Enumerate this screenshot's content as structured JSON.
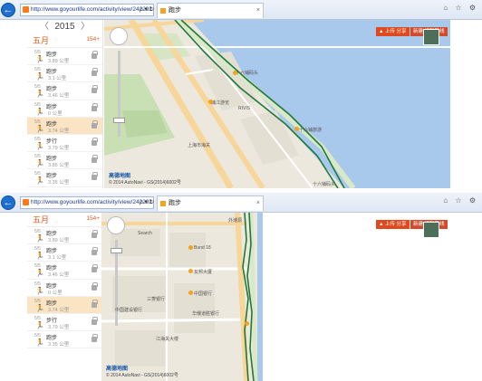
{
  "browser": {
    "back_icon": "←",
    "address": "http://www.goyourlife.com/activity/view/242292",
    "address_controls": "ρ ▾ ↻ ✕",
    "tab_title": "跑步",
    "tab_close": "×",
    "window_controls": "⌂ ☆ ⚙"
  },
  "sidebar_top": {
    "year": "2015",
    "prev": "〈",
    "next": "〉",
    "month": "五月",
    "month_count": "154+",
    "activities": [
      {
        "date": "5/5",
        "type": "跑步",
        "dist": "3.89 公里",
        "selected": false
      },
      {
        "date": "5/5",
        "type": "跑步",
        "dist": "3.1 公里",
        "selected": false
      },
      {
        "date": "5/5",
        "type": "跑步",
        "dist": "3.46 公里",
        "selected": false
      },
      {
        "date": "5/5",
        "type": "跑步",
        "dist": "0 公里",
        "selected": false
      },
      {
        "date": "5/5",
        "type": "跑步",
        "dist": "3.74 公里",
        "selected": true
      },
      {
        "date": "5/5",
        "type": "步行",
        "dist": "3.79 公里",
        "selected": false
      },
      {
        "date": "5/5",
        "type": "跑步",
        "dist": "3.85 公里",
        "selected": false
      },
      {
        "date": "5/5",
        "type": "跑步",
        "dist": "3.35 公里",
        "selected": false
      }
    ]
  },
  "sidebar_bottom": {
    "month": "五月",
    "month_count": "154+",
    "activities": [
      {
        "date": "5/5",
        "type": "跑步",
        "dist": "3.89 公里",
        "selected": false
      },
      {
        "date": "5/5",
        "type": "跑步",
        "dist": "3.1 公里",
        "selected": false
      },
      {
        "date": "5/5",
        "type": "跑步",
        "dist": "3.46 公里",
        "selected": false
      },
      {
        "date": "5/5",
        "type": "跑步",
        "dist": "0 公里",
        "selected": false
      },
      {
        "date": "5/5",
        "type": "跑步",
        "dist": "3.74 公里",
        "selected": true
      },
      {
        "date": "5/5",
        "type": "步行",
        "dist": "3.79 公里",
        "selected": false
      },
      {
        "date": "5/5",
        "type": "跑步",
        "dist": "3.35 公里",
        "selected": false
      }
    ]
  },
  "map_top": {
    "btn_share": "▲ 上传 分享",
    "btn_other": "新建/编辑路线",
    "labels": [
      "十六铺码头",
      "新开河路",
      "浦江游览",
      "RIVIS",
      "十六铺旅游",
      "上海市海关",
      "十六铺码头",
      "外滩",
      "中山东二路"
    ],
    "copyright": "© 2014 AutoNavi - GS(2014)6002号",
    "logo": "高德地图"
  },
  "map_bottom": {
    "btn_share": "▲ 上传 分享",
    "btn_other": "新建/编辑路线",
    "labels": [
      "Search",
      "Bund 18",
      "友邦大厦",
      "中国银行",
      "三菱银行",
      "华俄道胜银行",
      "江海关大楼",
      "中国建设银行",
      "外滩源",
      "汇丰银行",
      "招商局大楼",
      "上海汇中饭店",
      "上海总会",
      "海关大楼",
      "金融大厦",
      "外滩中心",
      "黄浦公园",
      "北京东路",
      "上海外滩"
    ],
    "copyright": "© 2014 AutoNavi - GS(2014)6002号",
    "logo": "高德地图"
  },
  "colors": {
    "accent": "#e25a1b",
    "selected_bg": "#fbe4c3",
    "route": "#1f7a3a",
    "water": "#a8c8ec",
    "road": "#f7d69a"
  },
  "icons": {
    "runner": "🏃",
    "lock": "lock-icon",
    "back": "back-arrow-icon",
    "layers": "satellite-layer-icon"
  }
}
